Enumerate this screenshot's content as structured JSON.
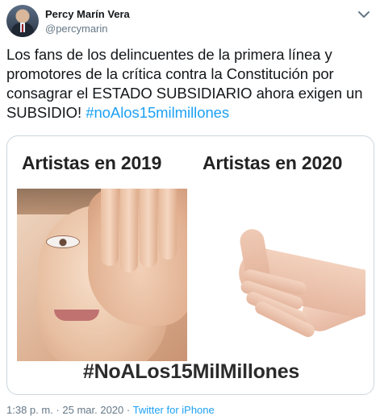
{
  "author": {
    "display_name": "Percy Marín Vera",
    "handle": "@percymarin",
    "avatar_icon": "user-avatar"
  },
  "header": {
    "more_icon": "chevron-down-icon"
  },
  "tweet": {
    "text_parts": [
      "Los fans de los delincuentes de la primera línea y promotores de la crítica contra la Constitución por consagrar el ESTADO SUBSIDIARIO ahora exigen un SUBSIDIO! "
    ],
    "hashtag": "#noAlos15milmillones",
    "hashtag_color": "#1da1f2"
  },
  "media": {
    "label_left": "Artistas en 2019",
    "label_right": "Artistas en 2020",
    "bottom_caption": "#NoALos15MilMillones"
  },
  "meta": {
    "time": "1:38 p. m.",
    "separator": " · ",
    "date": "25 mar. 2020",
    "source": "Twitter for iPhone"
  }
}
